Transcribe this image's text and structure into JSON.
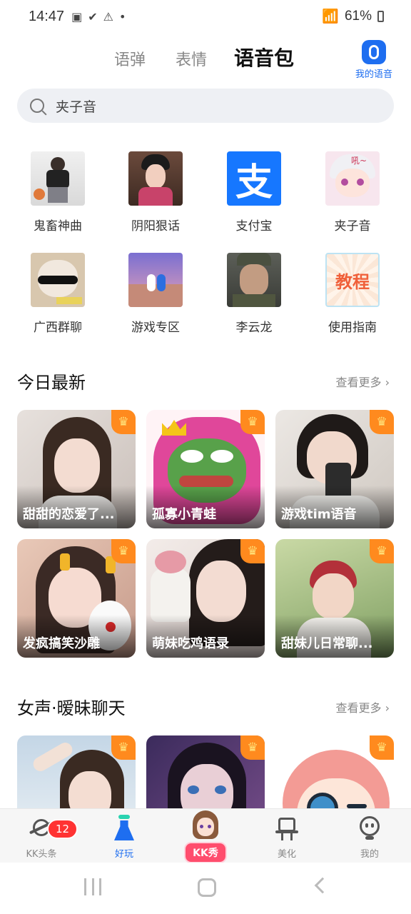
{
  "status": {
    "time": "14:47",
    "battery": "61%"
  },
  "tabs": {
    "t1": "语弹",
    "t2": "表情",
    "t3": "语音包",
    "my_voice": "我的语音"
  },
  "search": {
    "query": "夹子音"
  },
  "categories": [
    {
      "name": "鬼畜神曲"
    },
    {
      "name": "阴阳狠话"
    },
    {
      "name": "支付宝",
      "icon_text": "支"
    },
    {
      "name": "夹子音",
      "icon_text": "吼~"
    },
    {
      "name": "广西群聊"
    },
    {
      "name": "游戏专区"
    },
    {
      "name": "李云龙"
    },
    {
      "name": "使用指南",
      "icon_text": "教程"
    }
  ],
  "sections": {
    "today": {
      "title": "今日最新",
      "more": "查看更多"
    },
    "female": {
      "title": "女声·暧昧聊天",
      "more": "查看更多"
    }
  },
  "cards_today": [
    {
      "title": "甜甜的恋爱了..."
    },
    {
      "title": "孤寡小青蛙"
    },
    {
      "title": "游戏tim语音"
    },
    {
      "title": "发疯搞笑沙雕"
    },
    {
      "title": "萌妹吃鸡语录"
    },
    {
      "title": "甜妹儿日常聊..."
    }
  ],
  "bottom_nav": {
    "headline": "KK头条",
    "headline_badge": "12",
    "fun": "好玩",
    "show": "KK秀",
    "beauty": "美化",
    "me": "我的"
  },
  "colors": {
    "accent": "#1e6ef0",
    "crown": "#ff8a1e",
    "highlight": "#ffd93a",
    "alipay": "#1677ff"
  }
}
